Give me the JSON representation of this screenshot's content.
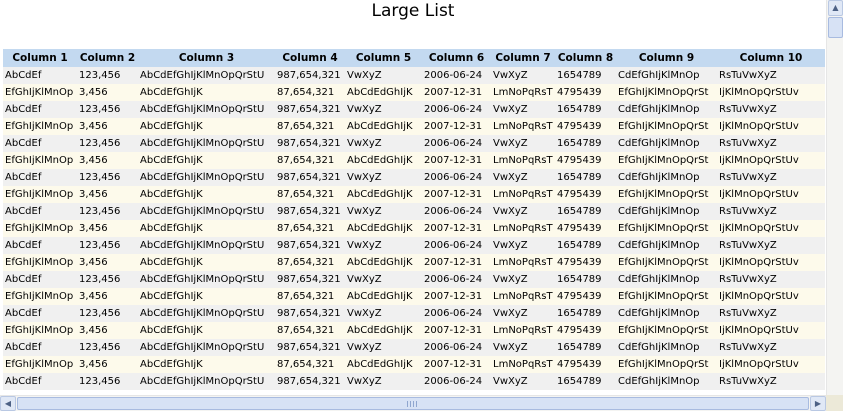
{
  "page": {
    "title": "Large List"
  },
  "table": {
    "columns": [
      "Column 1",
      "Column 2",
      "Column 3",
      "Column 4",
      "Column 5",
      "Column 6",
      "Column 7",
      "Column 8",
      "Column 9",
      "Column 10"
    ],
    "rows": [
      [
        "AbCdEf",
        "123,456",
        "AbCdEfGhIjKlMnOpQrStU",
        "987,654,321",
        "VwXyZ",
        "2006-06-24",
        "VwXyZ",
        "1654789",
        "CdEfGhIjKlMnOp",
        "RsTuVwXyZ"
      ],
      [
        "EfGhIjKlMnOp",
        "3,456",
        "AbCdEfGhIjK",
        "87,654,321",
        "AbCdEdGhIjK",
        "2007-12-31",
        "LmNoPqRsT",
        "4795439",
        "EfGhIjKlMnOpQrSt",
        "IjKlMnOpQrStUv"
      ],
      [
        "AbCdEf",
        "123,456",
        "AbCdEfGhIjKlMnOpQrStU",
        "987,654,321",
        "VwXyZ",
        "2006-06-24",
        "VwXyZ",
        "1654789",
        "CdEfGhIjKlMnOp",
        "RsTuVwXyZ"
      ],
      [
        "EfGhIjKlMnOp",
        "3,456",
        "AbCdEfGhIjK",
        "87,654,321",
        "AbCdEdGhIjK",
        "2007-12-31",
        "LmNoPqRsT",
        "4795439",
        "EfGhIjKlMnOpQrSt",
        "IjKlMnOpQrStUv"
      ],
      [
        "AbCdEf",
        "123,456",
        "AbCdEfGhIjKlMnOpQrStU",
        "987,654,321",
        "VwXyZ",
        "2006-06-24",
        "VwXyZ",
        "1654789",
        "CdEfGhIjKlMnOp",
        "RsTuVwXyZ"
      ],
      [
        "EfGhIjKlMnOp",
        "3,456",
        "AbCdEfGhIjK",
        "87,654,321",
        "AbCdEdGhIjK",
        "2007-12-31",
        "LmNoPqRsT",
        "4795439",
        "EfGhIjKlMnOpQrSt",
        "IjKlMnOpQrStUv"
      ],
      [
        "AbCdEf",
        "123,456",
        "AbCdEfGhIjKlMnOpQrStU",
        "987,654,321",
        "VwXyZ",
        "2006-06-24",
        "VwXyZ",
        "1654789",
        "CdEfGhIjKlMnOp",
        "RsTuVwXyZ"
      ],
      [
        "EfGhIjKlMnOp",
        "3,456",
        "AbCdEfGhIjK",
        "87,654,321",
        "AbCdEdGhIjK",
        "2007-12-31",
        "LmNoPqRsT",
        "4795439",
        "EfGhIjKlMnOpQrSt",
        "IjKlMnOpQrStUv"
      ],
      [
        "AbCdEf",
        "123,456",
        "AbCdEfGhIjKlMnOpQrStU",
        "987,654,321",
        "VwXyZ",
        "2006-06-24",
        "VwXyZ",
        "1654789",
        "CdEfGhIjKlMnOp",
        "RsTuVwXyZ"
      ],
      [
        "EfGhIjKlMnOp",
        "3,456",
        "AbCdEfGhIjK",
        "87,654,321",
        "AbCdEdGhIjK",
        "2007-12-31",
        "LmNoPqRsT",
        "4795439",
        "EfGhIjKlMnOpQrSt",
        "IjKlMnOpQrStUv"
      ],
      [
        "AbCdEf",
        "123,456",
        "AbCdEfGhIjKlMnOpQrStU",
        "987,654,321",
        "VwXyZ",
        "2006-06-24",
        "VwXyZ",
        "1654789",
        "CdEfGhIjKlMnOp",
        "RsTuVwXyZ"
      ],
      [
        "EfGhIjKlMnOp",
        "3,456",
        "AbCdEfGhIjK",
        "87,654,321",
        "AbCdEdGhIjK",
        "2007-12-31",
        "LmNoPqRsT",
        "4795439",
        "EfGhIjKlMnOpQrSt",
        "IjKlMnOpQrStUv"
      ],
      [
        "AbCdEf",
        "123,456",
        "AbCdEfGhIjKlMnOpQrStU",
        "987,654,321",
        "VwXyZ",
        "2006-06-24",
        "VwXyZ",
        "1654789",
        "CdEfGhIjKlMnOp",
        "RsTuVwXyZ"
      ],
      [
        "EfGhIjKlMnOp",
        "3,456",
        "AbCdEfGhIjK",
        "87,654,321",
        "AbCdEdGhIjK",
        "2007-12-31",
        "LmNoPqRsT",
        "4795439",
        "EfGhIjKlMnOpQrSt",
        "IjKlMnOpQrStUv"
      ],
      [
        "AbCdEf",
        "123,456",
        "AbCdEfGhIjKlMnOpQrStU",
        "987,654,321",
        "VwXyZ",
        "2006-06-24",
        "VwXyZ",
        "1654789",
        "CdEfGhIjKlMnOp",
        "RsTuVwXyZ"
      ],
      [
        "EfGhIjKlMnOp",
        "3,456",
        "AbCdEfGhIjK",
        "87,654,321",
        "AbCdEdGhIjK",
        "2007-12-31",
        "LmNoPqRsT",
        "4795439",
        "EfGhIjKlMnOpQrSt",
        "IjKlMnOpQrStUv"
      ],
      [
        "AbCdEf",
        "123,456",
        "AbCdEfGhIjKlMnOpQrStU",
        "987,654,321",
        "VwXyZ",
        "2006-06-24",
        "VwXyZ",
        "1654789",
        "CdEfGhIjKlMnOp",
        "RsTuVwXyZ"
      ],
      [
        "EfGhIjKlMnOp",
        "3,456",
        "AbCdEfGhIjK",
        "87,654,321",
        "AbCdEdGhIjK",
        "2007-12-31",
        "LmNoPqRsT",
        "4795439",
        "EfGhIjKlMnOpQrSt",
        "IjKlMnOpQrStUv"
      ],
      [
        "AbCdEf",
        "123,456",
        "AbCdEfGhIjKlMnOpQrStU",
        "987,654,321",
        "VwXyZ",
        "2006-06-24",
        "VwXyZ",
        "1654789",
        "CdEfGhIjKlMnOp",
        "RsTuVwXyZ"
      ]
    ]
  },
  "scrollbars": {
    "up_icon": "arrow-up-icon",
    "left_icon": "arrow-left-icon",
    "right_icon": "arrow-right-icon",
    "up_glyph": "▲",
    "left_glyph": "◀",
    "right_glyph": "▶"
  },
  "colors": {
    "header_bg": "#c3d9f0",
    "row_odd_bg": "#f0f0f0",
    "row_even_bg": "#fdfaeb"
  }
}
